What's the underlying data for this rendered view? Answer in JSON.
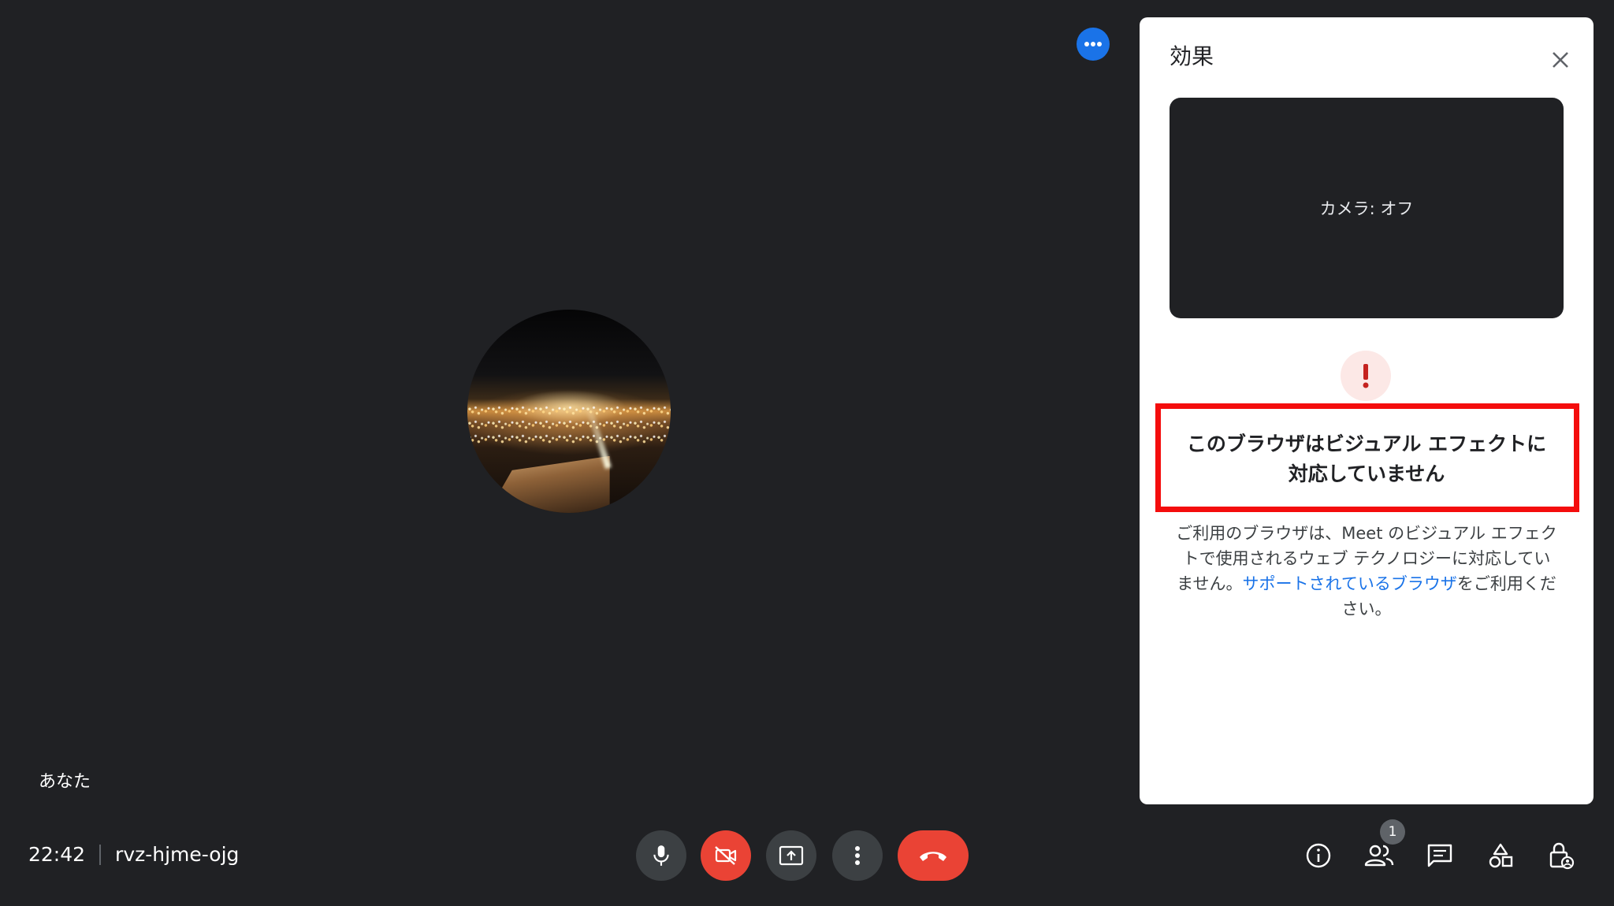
{
  "stage": {
    "self_label": "あなた",
    "more_options_icon": "more-horiz-icon"
  },
  "bottom_bar": {
    "time": "22:42",
    "meeting_code": "rvz-hjme-ojg",
    "controls": {
      "mic_icon": "mic-icon",
      "camera_icon": "videocam-off-icon",
      "present_icon": "present-to-all-icon",
      "more_icon": "more-vert-icon",
      "leave_icon": "call-end-icon"
    },
    "right_icons": {
      "info": "info-icon",
      "people": "people-icon",
      "people_count": "1",
      "chat": "chat-icon",
      "activities": "activities-icon",
      "host_controls": "host-controls-icon"
    }
  },
  "effects_panel": {
    "title": "効果",
    "camera_status": "カメラ: オフ",
    "warning_title_line1": "このブラウザはビジュアル エフェクトに",
    "warning_title_line2": "対応していません",
    "warning_desc_prefix": "ご利用のブラウザは、Meet のビジュアル エフェクトで使用されるウェブ テクノロジーに対応していません。",
    "warning_desc_link": "サポートされているブラウザ",
    "warning_desc_suffix": "をご利用ください。"
  },
  "colors": {
    "background": "#202124",
    "accent_blue": "#1a73e8",
    "danger_red": "#ea4335",
    "highlight_red": "#f40d0d",
    "control_gray": "#3c4043"
  }
}
